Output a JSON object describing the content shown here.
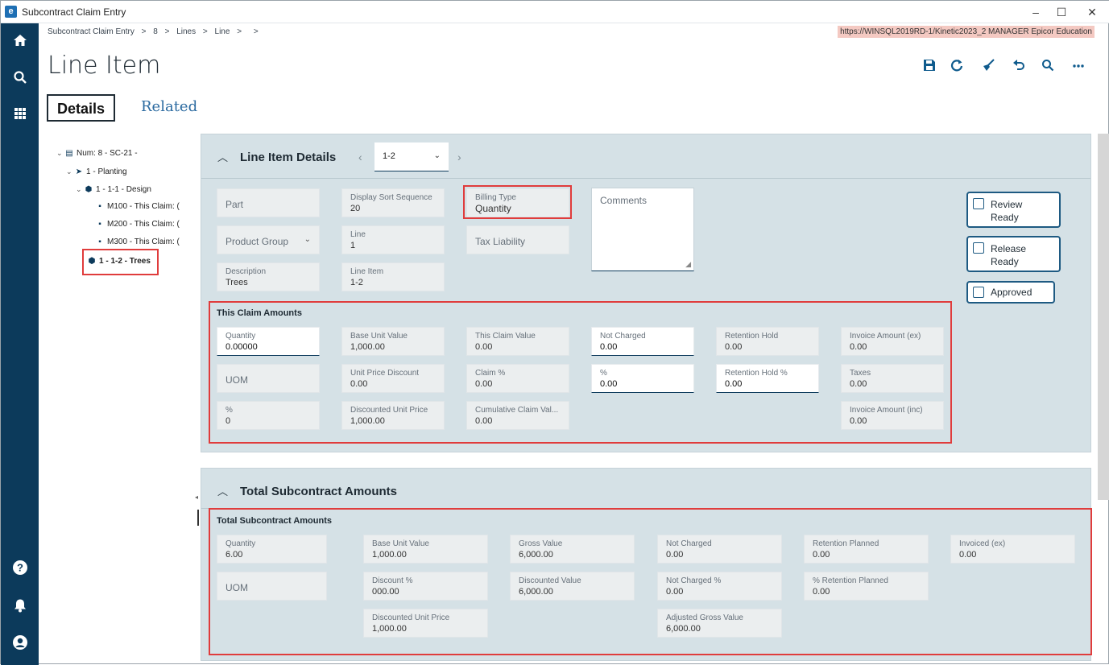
{
  "window": {
    "title": "Subcontract Claim Entry",
    "logo": "e",
    "min": "–",
    "max": "☐",
    "close": "✕"
  },
  "rail": {
    "home_icon": "home-icon",
    "search_icon": "search-icon",
    "apps_icon": "apps-grid-icon",
    "help_icon": "help-icon",
    "bell_icon": "bell-icon",
    "user_icon": "user-icon"
  },
  "breadcrumb": {
    "items": [
      "Subcontract Claim Entry",
      "8",
      "Lines",
      "Line",
      ""
    ],
    "separator": ">"
  },
  "env_info": "https://WINSQL2019RD-1/Kinetic2023_2   MANAGER   Epicor Education",
  "page_title": "Line Item",
  "tabs": {
    "details": "Details",
    "related": "Related"
  },
  "tree": {
    "root": "Num: 8 - SC-21 -",
    "n1": "1 - Planting",
    "n2": "1 - 1-1 - Design",
    "m1": "M100 - This Claim: (",
    "m2": "M200 - This Claim: (",
    "m3": "M300 - This Claim: (",
    "n3": "1 - 1-2 - Trees"
  },
  "line_details": {
    "title": "Line Item Details",
    "selector_value": "1-2",
    "part_label": "Part",
    "display_sort_label": "Display Sort Sequence",
    "display_sort_value": "20",
    "billing_type_label": "Billing Type",
    "billing_type_value": "Quantity",
    "comments_label": "Comments",
    "product_group_label": "Product Group",
    "line_label": "Line",
    "line_value": "1",
    "tax_liability_label": "Tax Liability",
    "description_label": "Description",
    "description_value": "Trees",
    "line_item_label": "Line Item",
    "line_item_value": "1-2",
    "review_ready": "Review\nReady",
    "release_ready": "Release\nReady",
    "approved": "Approved"
  },
  "this_claim": {
    "title": "This Claim Amounts",
    "quantity_label": "Quantity",
    "quantity_value": "0.00000",
    "base_unit_label": "Base Unit Value",
    "base_unit_value": "1,000.00",
    "claim_value_label": "This Claim Value",
    "claim_value_value": "0.00",
    "not_charged_label": "Not Charged",
    "not_charged_value": "0.00",
    "retention_hold_label": "Retention Hold",
    "retention_hold_value": "0.00",
    "invoice_ex_label": "Invoice Amount (ex)",
    "invoice_ex_value": "0.00",
    "uom_label": "UOM",
    "unit_disc_label": "Unit Price Discount",
    "unit_disc_value": "0.00",
    "claim_pct_label": "Claim %",
    "claim_pct_value": "0.00",
    "pct_label": "%",
    "pct_value": "0.00",
    "retention_hold_pct_label": "Retention Hold %",
    "retention_hold_pct_value": "0.00",
    "taxes_label": "Taxes",
    "taxes_value": "0.00",
    "pct2_label": "%",
    "pct2_value": "0",
    "disc_unit_label": "Discounted Unit Price",
    "disc_unit_value": "1,000.00",
    "cum_claim_label": "Cumulative Claim Val...",
    "cum_claim_value": "0.00",
    "invoice_inc_label": "Invoice Amount (inc)",
    "invoice_inc_value": "0.00"
  },
  "totals": {
    "panel_title": "Total Subcontract Amounts",
    "title": "Total Subcontract Amounts",
    "quantity_label": "Quantity",
    "quantity_value": "6.00",
    "base_unit_label": "Base Unit Value",
    "base_unit_value": "1,000.00",
    "gross_label": "Gross Value",
    "gross_value": "6,000.00",
    "not_charged_label": "Not Charged",
    "not_charged_value": "0.00",
    "ret_planned_label": "Retention Planned",
    "ret_planned_value": "0.00",
    "invoiced_label": "Invoiced (ex)",
    "invoiced_value": "0.00",
    "uom_label": "UOM",
    "discount_pct_label": "Discount %",
    "discount_pct_value": "000.00",
    "disc_value_label": "Discounted Value",
    "disc_value_value": "6,000.00",
    "not_charged_pct_label": "Not Charged %",
    "not_charged_pct_value": "0.00",
    "pct_ret_label": "% Retention Planned",
    "pct_ret_value": "0.00",
    "disc_unit_label": "Discounted Unit Price",
    "disc_unit_value": "1,000.00",
    "adj_gross_label": "Adjusted Gross Value",
    "adj_gross_value": "6,000.00"
  },
  "colors": {
    "rail": "#0c3a5b",
    "panel": "#d5e1e6",
    "highlight": "#e03c3c",
    "accent": "#0f5b8d"
  }
}
